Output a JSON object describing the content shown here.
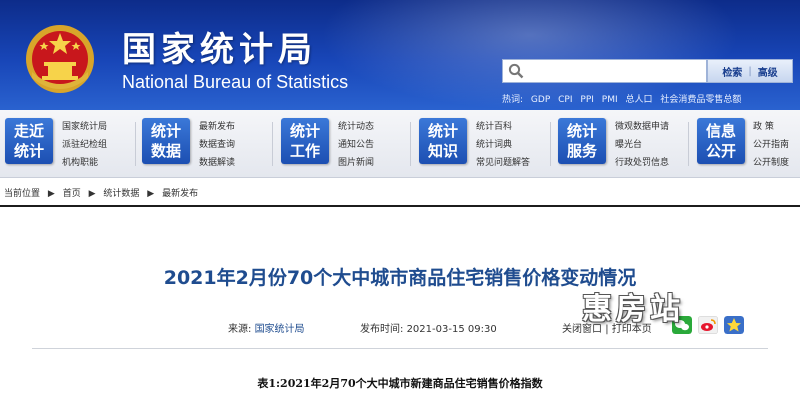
{
  "header": {
    "site_name_cn": "国家统计局",
    "site_name_en": "National Bureau of Statistics",
    "search": {
      "placeholder": "",
      "button_search": "检索",
      "button_advanced": "高级"
    },
    "hot": {
      "label": "热词:",
      "items": [
        "GDP",
        "CPI",
        "PPI",
        "PMI",
        "总人口",
        "社会消费品零售总额"
      ]
    }
  },
  "nav": [
    {
      "tile": [
        "走近",
        "统计"
      ],
      "links": [
        "国家统计局",
        "派驻纪检组",
        "机构职能"
      ]
    },
    {
      "tile": [
        "统计",
        "数据"
      ],
      "links": [
        "最新发布",
        "数据查询",
        "数据解读"
      ]
    },
    {
      "tile": [
        "统计",
        "工作"
      ],
      "links": [
        "统计动态",
        "通知公告",
        "图片新闻"
      ]
    },
    {
      "tile": [
        "统计",
        "知识"
      ],
      "links": [
        "统计百科",
        "统计词典",
        "常见问题解答"
      ]
    },
    {
      "tile": [
        "统计",
        "服务"
      ],
      "links": [
        "微观数据申请",
        "曝光台",
        "行政处罚信息"
      ]
    },
    {
      "tile": [
        "信息",
        "公开"
      ],
      "links": [
        "政 策",
        "公开指南",
        "公开制度"
      ]
    }
  ],
  "breadcrumb": [
    "当前位置",
    "首页",
    "统计数据",
    "最新发布"
  ],
  "article": {
    "title": "2021年2月份70个大中城市商品住宅销售价格变动情况",
    "source_label": "来源:",
    "source": "国家统计局",
    "time_label": "发布时间:",
    "time": "2021-03-15 09:30",
    "close_label": "关闭窗口",
    "print_label": "打印本页",
    "table_title": "表1:2021年2月70个大中城市新建商品住宅销售价格指数"
  },
  "watermark": "惠房站",
  "colors": {
    "header_blue": "#1846b8",
    "title_blue": "#1f4c8f",
    "tile_blue": "#2a62cf"
  }
}
